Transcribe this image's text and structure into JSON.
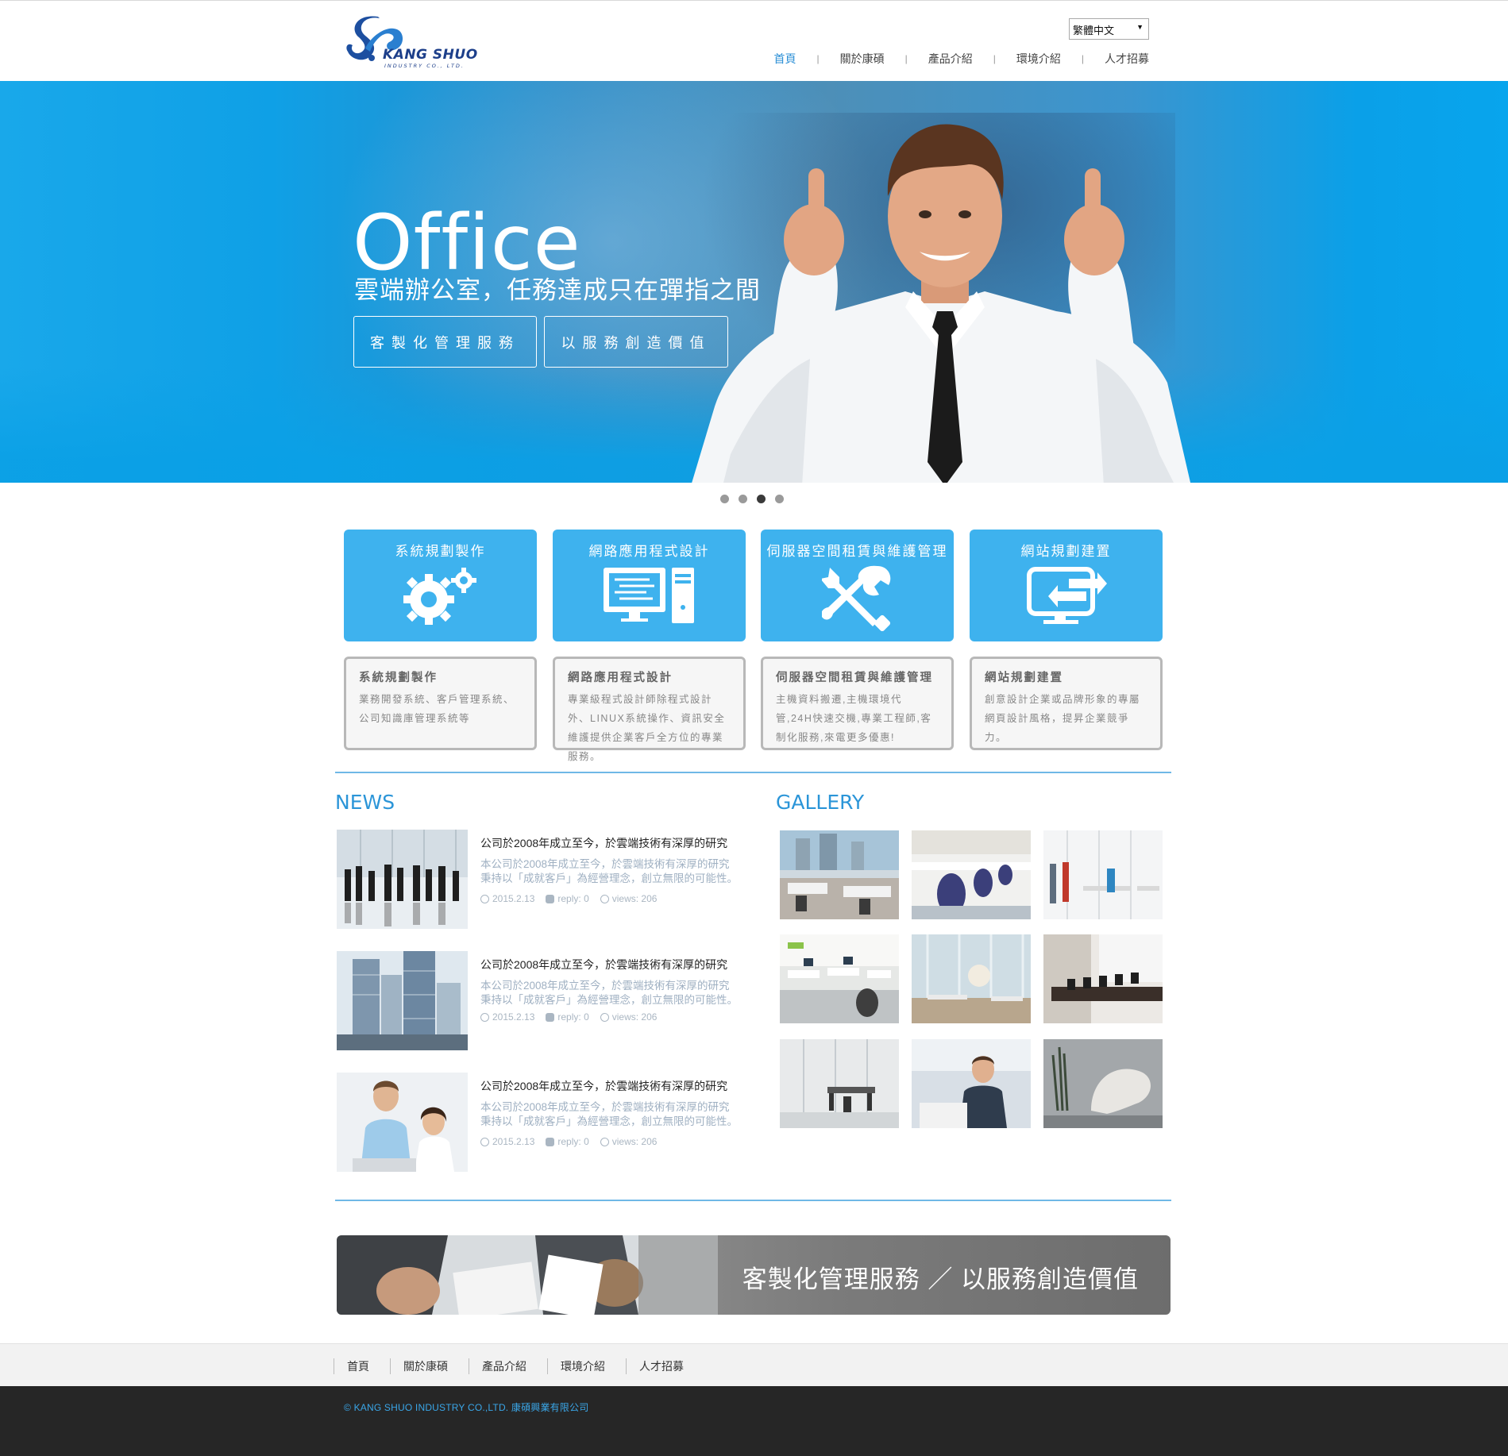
{
  "header": {
    "logo_text": "KANG SHUO",
    "logo_sub": "INDUSTRY CO., LTD.",
    "language": "繁體中文",
    "nav": [
      "首頁",
      "關於康碩",
      "產品介紹",
      "環境介紹",
      "人才招募"
    ]
  },
  "hero": {
    "title": "Office",
    "subtitle": "雲端辦公室，任務達成只在彈指之間",
    "button1": "客製化管理服務",
    "button2": "以服務創造價值",
    "slides": 4,
    "active_slide": 3
  },
  "services": [
    {
      "label": "系統規劃製作",
      "icon": "gears-icon",
      "title": "系統規劃製作",
      "desc": "業務開發系統、客戶管理系統、公司知識庫管理系統等"
    },
    {
      "label": "網路應用程式設計",
      "icon": "computer-icon",
      "title": "網路應用程式設計",
      "desc": "專業級程式設計師除程式設計外、LINUX系統操作、資訊安全維護提供企業客戶全方位的專業服務。"
    },
    {
      "label": "伺服器空間租賃與維護管理",
      "icon": "tools-icon",
      "title": "伺服器空間租賃與維護管理",
      "desc": "主機資料搬遷,主機環境代管,24H快速交機,專業工程師,客制化服務,來電更多優惠!"
    },
    {
      "label": "網站規劃建置",
      "icon": "monitor-arrows-icon",
      "title": "網站規劃建置",
      "desc": "創意設計企業或品牌形象的專屬網頁設計風格，提昇企業競爭力。"
    }
  ],
  "news": {
    "title": "NEWS",
    "items": [
      {
        "headline": "公司於2008年成立至今，於雲端技術有深厚的研究",
        "body1": "本公司於2008年成立至今，於雲端技術有深厚的研究",
        "body2": "秉持以「成就客戶」為經營理念，創立無限的可能性。",
        "date": "2015.2.13",
        "reply": "reply: 0",
        "views": "views: 206"
      },
      {
        "headline": "公司於2008年成立至今，於雲端技術有深厚的研究",
        "body1": "本公司於2008年成立至今，於雲端技術有深厚的研究",
        "body2": "秉持以「成就客戶」為經營理念，創立無限的可能性。",
        "date": "2015.2.13",
        "reply": "reply: 0",
        "views": "views: 206"
      },
      {
        "headline": "公司於2008年成立至今，於雲端技術有深厚的研究",
        "body1": "本公司於2008年成立至今，於雲端技術有深厚的研究",
        "body2": "秉持以「成就客戶」為經營理念，創立無限的可能性。",
        "date": "2015.2.13",
        "reply": "reply: 0",
        "views": "views: 206"
      }
    ]
  },
  "gallery": {
    "title": "GALLERY",
    "count": 9
  },
  "banner": {
    "text": "客製化管理服務 ／ 以服務創造價值"
  },
  "footer": {
    "links": [
      "首頁",
      "關於康碩",
      "產品介紹",
      "環境介紹",
      "人才招募"
    ],
    "copyright": "© KANG SHUO INDUSTRY CO.,LTD.  康碩興業有限公司"
  },
  "colors": {
    "accent": "#3eb2ee",
    "link_active": "#2b8fd6",
    "footer_dark": "#262626"
  }
}
